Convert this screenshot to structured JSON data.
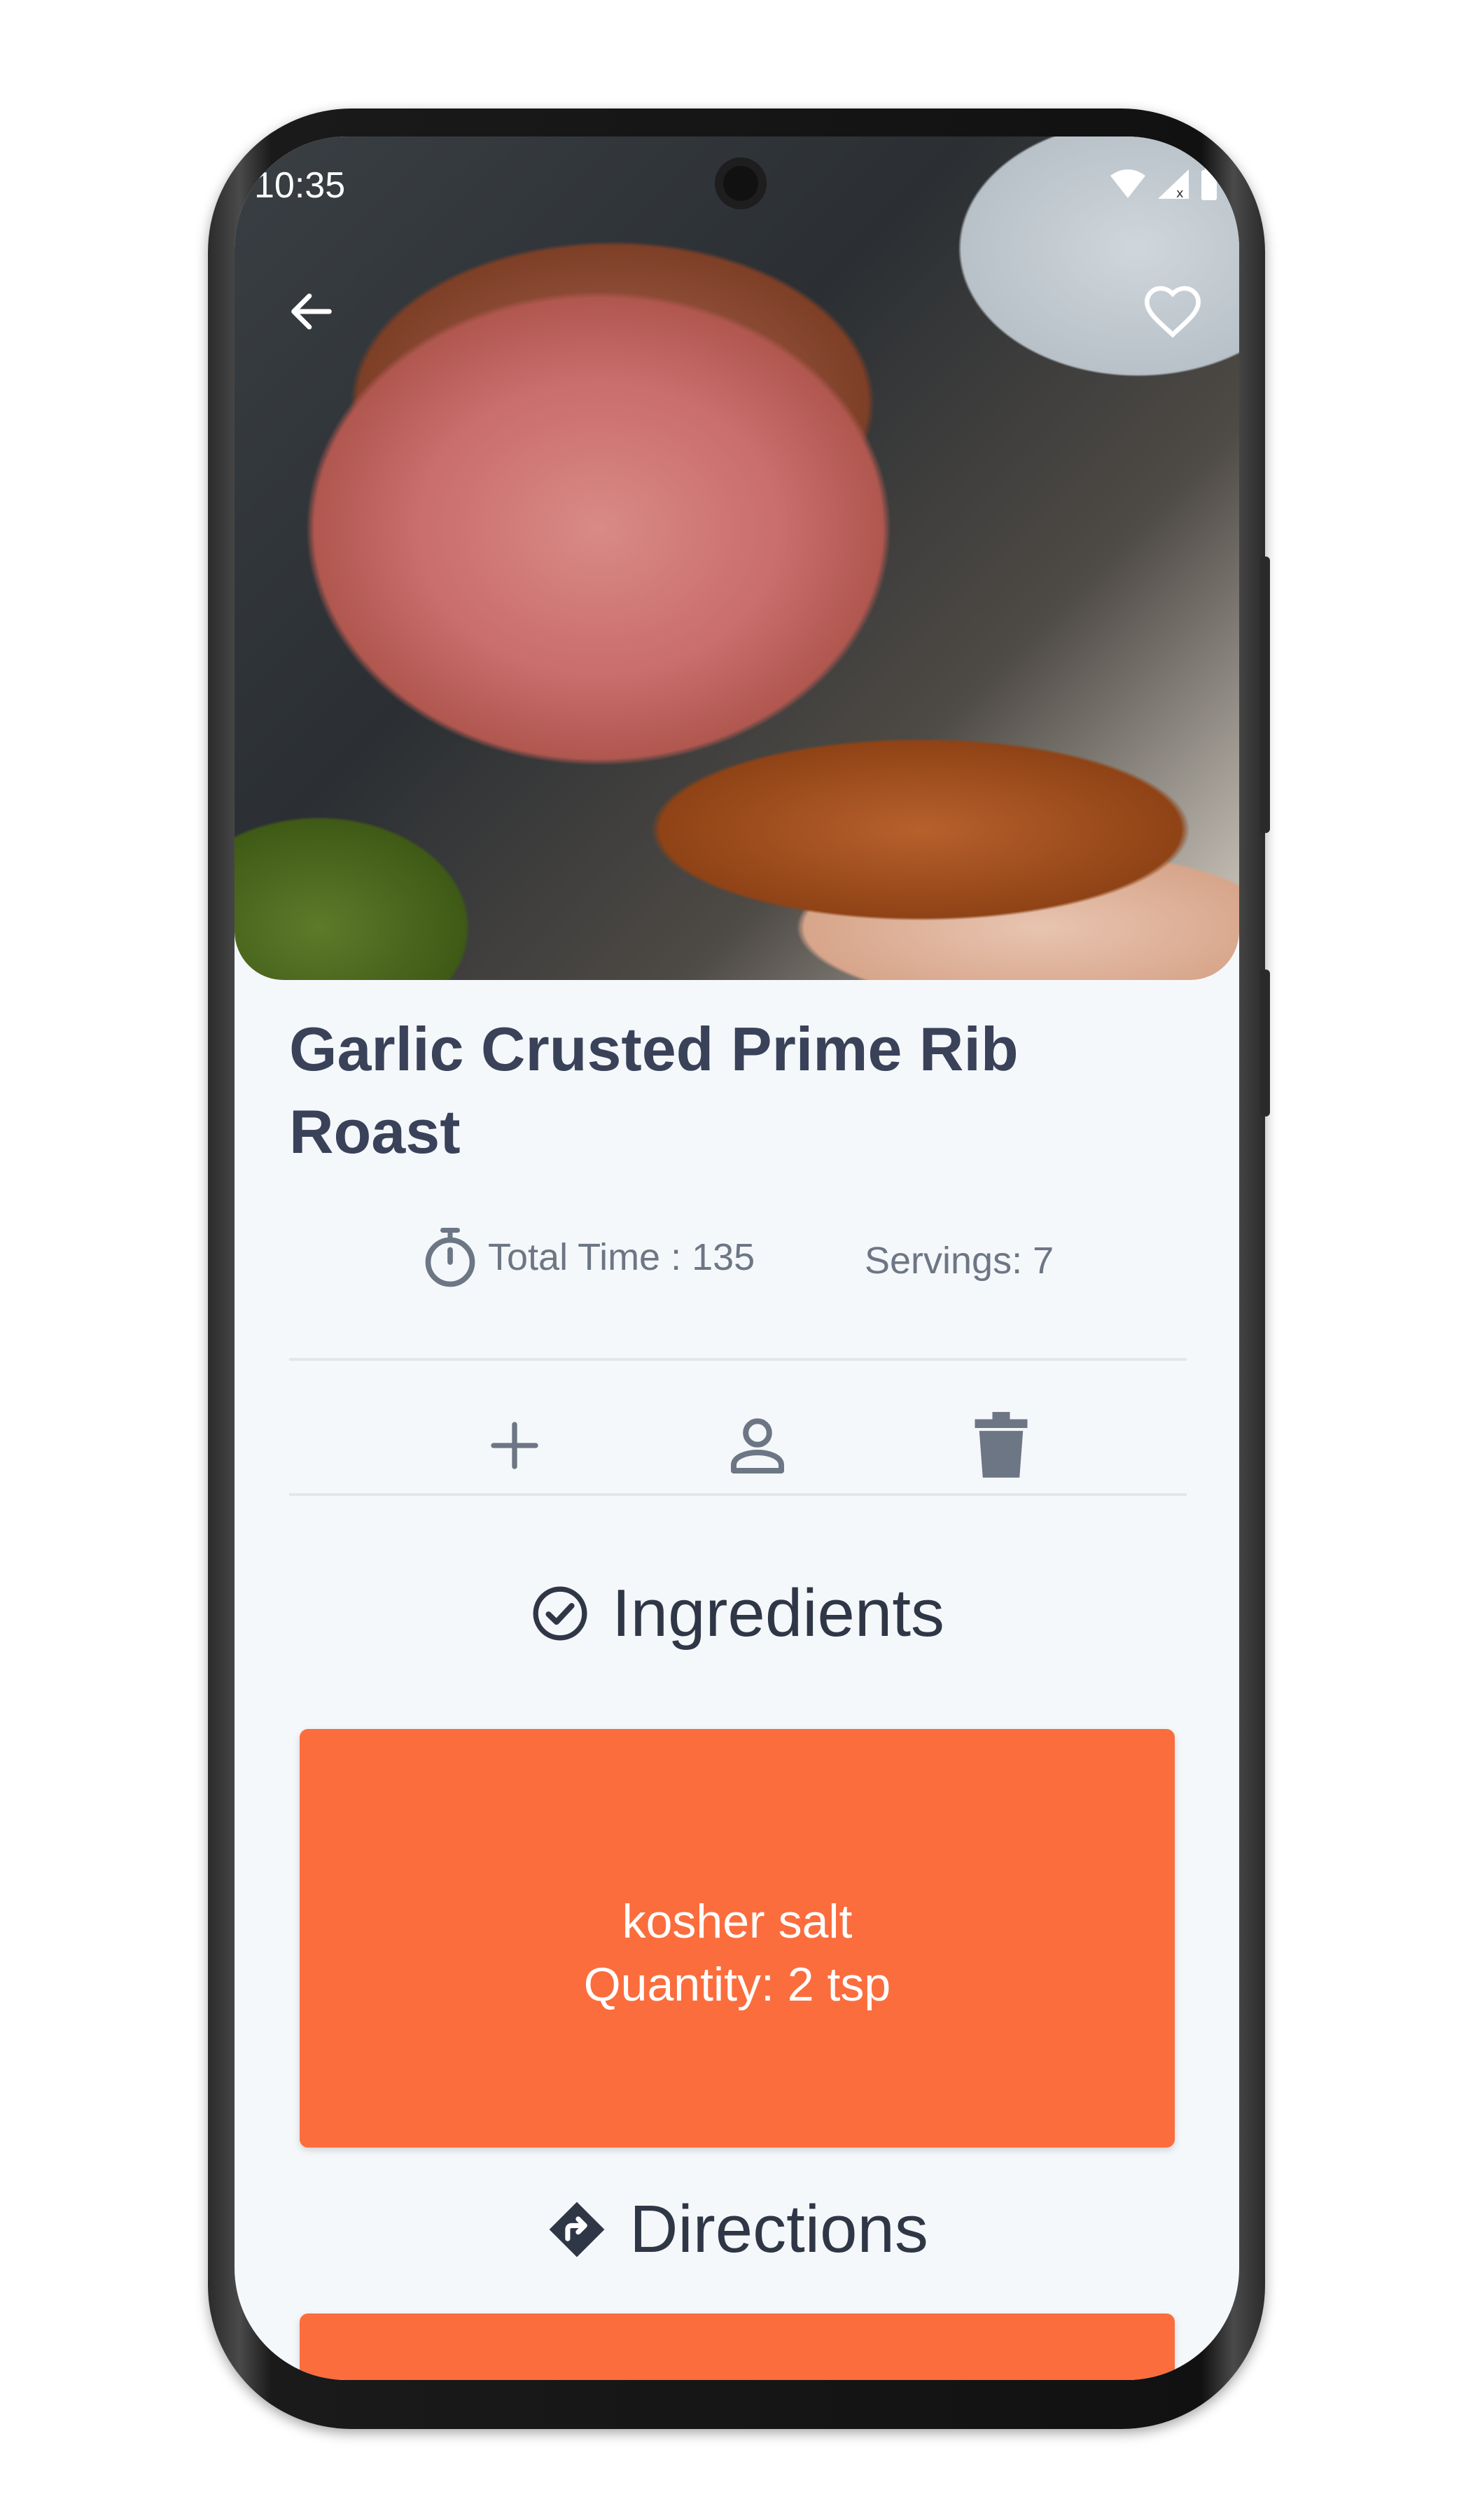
{
  "status_bar": {
    "time": "10:35"
  },
  "recipe": {
    "title": "Garlic Crusted Prime Rib Roast",
    "total_time_label": "Total Time : 135",
    "servings_label": "Servings: 7"
  },
  "sections": {
    "ingredients_title": "Ingredients",
    "directions_title": "Directions"
  },
  "ingredients": [
    {
      "name": "kosher salt",
      "quantity_label": "Quantity:  2  tsp"
    }
  ],
  "colors": {
    "accent": "#fb6d3d",
    "background": "#f5f8fb",
    "title": "#3a4259",
    "icon_gray": "#6d7684"
  },
  "icons": {
    "back": "arrow-left",
    "favorite": "heart-outline",
    "timer": "stopwatch",
    "add": "plus",
    "person": "person-outline",
    "delete": "trash",
    "ingredients": "check-circle",
    "directions": "directions-diamond"
  }
}
